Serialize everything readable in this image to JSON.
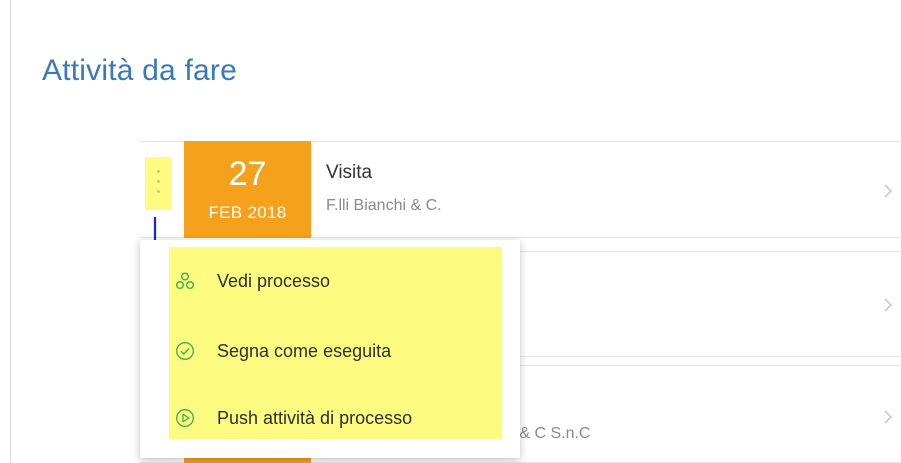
{
  "page": {
    "title": "Attività da fare"
  },
  "activities": [
    {
      "day": "27",
      "month": "FEB 2018",
      "title": "Visita",
      "subtitle": "F.lli Bianchi & C."
    },
    {
      "title": "",
      "subtitle": ""
    },
    {
      "title": "",
      "subtitle": "o & C S.n.C"
    }
  ],
  "context_menu": {
    "items": [
      {
        "label": "Vedi processo",
        "icon": "process-icon"
      },
      {
        "label": "Segna come eseguita",
        "icon": "check-circle-icon"
      },
      {
        "label": "Push attività di processo",
        "icon": "play-circle-icon"
      }
    ]
  },
  "colors": {
    "accent": "#3a79b4",
    "date_bg": "#f5a11b",
    "highlight": "#fdfc80",
    "icon_green": "#3fae49",
    "annotation_arrow": "#1a22e0"
  }
}
